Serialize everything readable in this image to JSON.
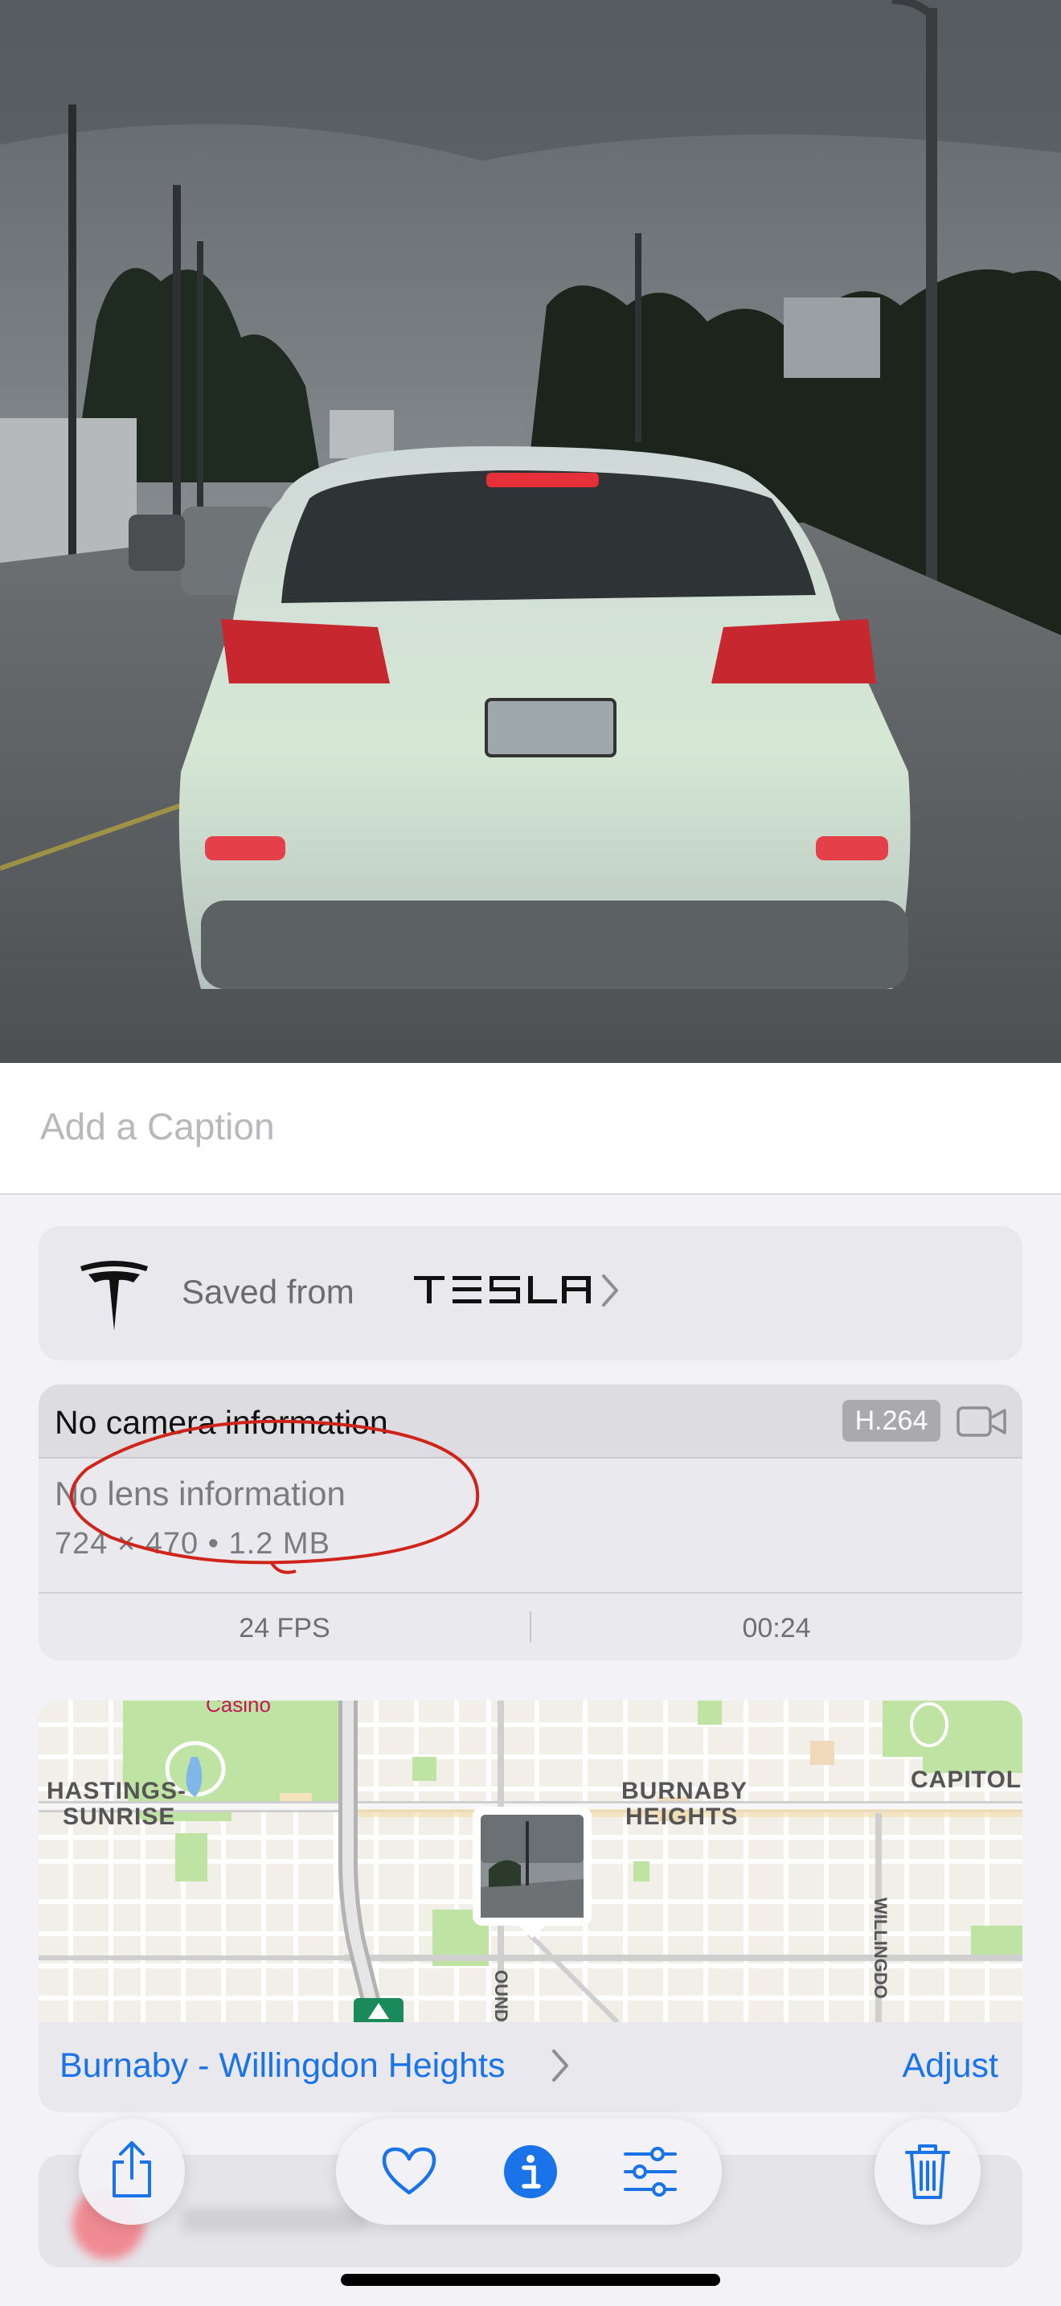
{
  "caption": {
    "placeholder": "Add a Caption"
  },
  "source": {
    "prefix": "Saved from",
    "brand": "TESLA",
    "logo_icon": "tesla-t-logo-icon",
    "chevron_icon": "chevron-right-icon"
  },
  "camera": {
    "title": "No camera information",
    "codec": "H.264",
    "type_icon": "video-camera-icon",
    "lens": "No lens information",
    "dimensions": "724 × 470  •  1.2 MB",
    "fps": "24 FPS",
    "duration": "00:24"
  },
  "map": {
    "labels": {
      "poi": "Casino",
      "hastings_1": "HASTINGS-",
      "hastings_2": "SUNRISE",
      "burnaby_1": "BURNABY",
      "burnaby_2": "HEIGHTS",
      "capitol": "CAPITOL H",
      "street_boundary": "OUNDAR",
      "street_willingdon": "WILLINGDO"
    },
    "location_name": "Burnaby - Willingdon Heights",
    "adjust_label": "Adjust"
  },
  "toolbar": {
    "share_icon": "share-icon",
    "favorite_icon": "heart-icon",
    "info_icon": "info-icon",
    "edit_icon": "adjust-sliders-icon",
    "delete_icon": "trash-icon"
  },
  "colors": {
    "accent": "#1a73e8",
    "annotation": "#d0231a",
    "card_bg": "#e8e8ed",
    "page_bg": "#f2f2f7"
  }
}
